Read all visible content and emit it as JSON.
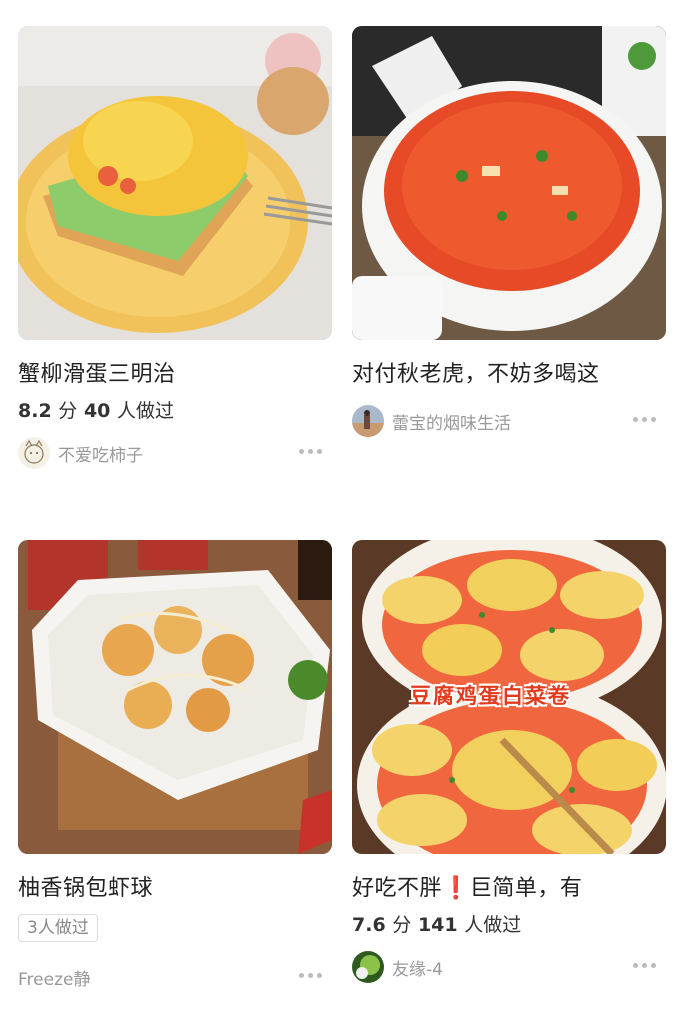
{
  "cards": [
    {
      "title": "蟹柳滑蛋三明治",
      "rating": "8.2",
      "rating_unit": "分",
      "cooked_count": "40",
      "cooked_unit": "人做过",
      "author": "不爱吃柿子",
      "image_icon": "sandwich-photo"
    },
    {
      "title": "对付秋老虎，不妨多喝这",
      "author": "蕾宝的烟味生活",
      "image_icon": "tomato-soup-photo"
    },
    {
      "title": "柚香锅包虾球",
      "badge": "3人做过",
      "author": "Freeze静",
      "image_icon": "shrimp-balls-photo"
    },
    {
      "title_part1": "好吃不胖",
      "title_excl": "❗",
      "title_part2": "巨简单，有",
      "rating": "7.6",
      "rating_unit": "分",
      "cooked_count": "141",
      "cooked_unit": "人做过",
      "author": "友缘-4",
      "image_overlay_text": "豆腐鸡蛋白菜卷",
      "image_icon": "cabbage-rolls-photo"
    }
  ],
  "colors": {
    "accent_red": "#e02020",
    "meta_gray": "#999999"
  }
}
